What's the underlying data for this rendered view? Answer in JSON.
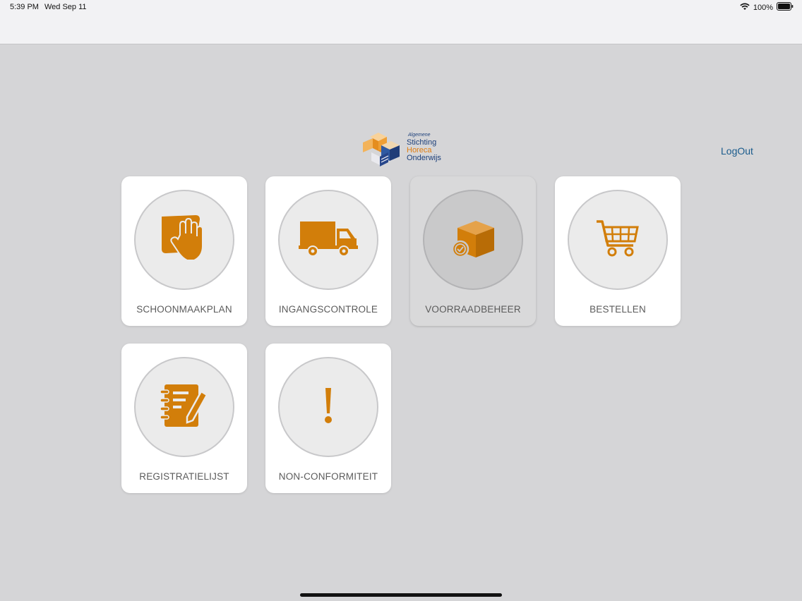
{
  "status": {
    "time": "5:39 PM",
    "date": "Wed Sep 11",
    "battery": "100%"
  },
  "logo": {
    "line1": "Algemene",
    "line2": "Stichting",
    "line3": "Horeca",
    "line4": "Onderwijs"
  },
  "header": {
    "logout_label": "LogOut"
  },
  "tiles": [
    {
      "label": "SCHOONMAAKPLAN",
      "icon": "cleaning-hand-icon"
    },
    {
      "label": "INGANGSCONTROLE",
      "icon": "truck-icon"
    },
    {
      "label": "VOORRAADBEHEER",
      "icon": "box-check-icon"
    },
    {
      "label": "BESTELLEN",
      "icon": "shopping-cart-icon"
    },
    {
      "label": "REGISTRATIELIJST",
      "icon": "notebook-pen-icon"
    },
    {
      "label": "NON-CONFORMITEIT",
      "icon": "exclamation-icon"
    }
  ],
  "colors": {
    "accent": "#d27e0a",
    "background": "#d5d5d7",
    "link": "#1a5b8c"
  }
}
